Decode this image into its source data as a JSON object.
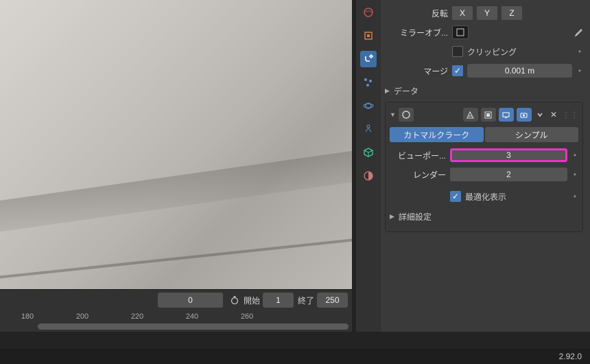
{
  "mirror": {
    "invert_label": "反転",
    "axes": [
      "X",
      "Y",
      "Z"
    ],
    "object_label": "ミラーオブ...",
    "clipping_label": "クリッピング",
    "clipping_on": false,
    "merge_label": "マージ",
    "merge_on": true,
    "merge_value": "0.001 m",
    "data_label": "データ"
  },
  "subsurf": {
    "method_catmull": "カトマルクラーク",
    "method_simple": "シンプル",
    "viewport_label": "ビューポー...",
    "viewport_value": "3",
    "render_label": "レンダー",
    "render_value": "2",
    "optimal_label": "最適化表示",
    "optimal_on": true,
    "advanced_label": "詳細設定"
  },
  "timeline": {
    "frame_current": "0",
    "start_label": "開始",
    "start_value": "1",
    "end_label": "終了",
    "end_value": "250",
    "ticks": [
      "180",
      "200",
      "220",
      "240",
      "260"
    ]
  },
  "status": {
    "version": "2.92.0"
  }
}
